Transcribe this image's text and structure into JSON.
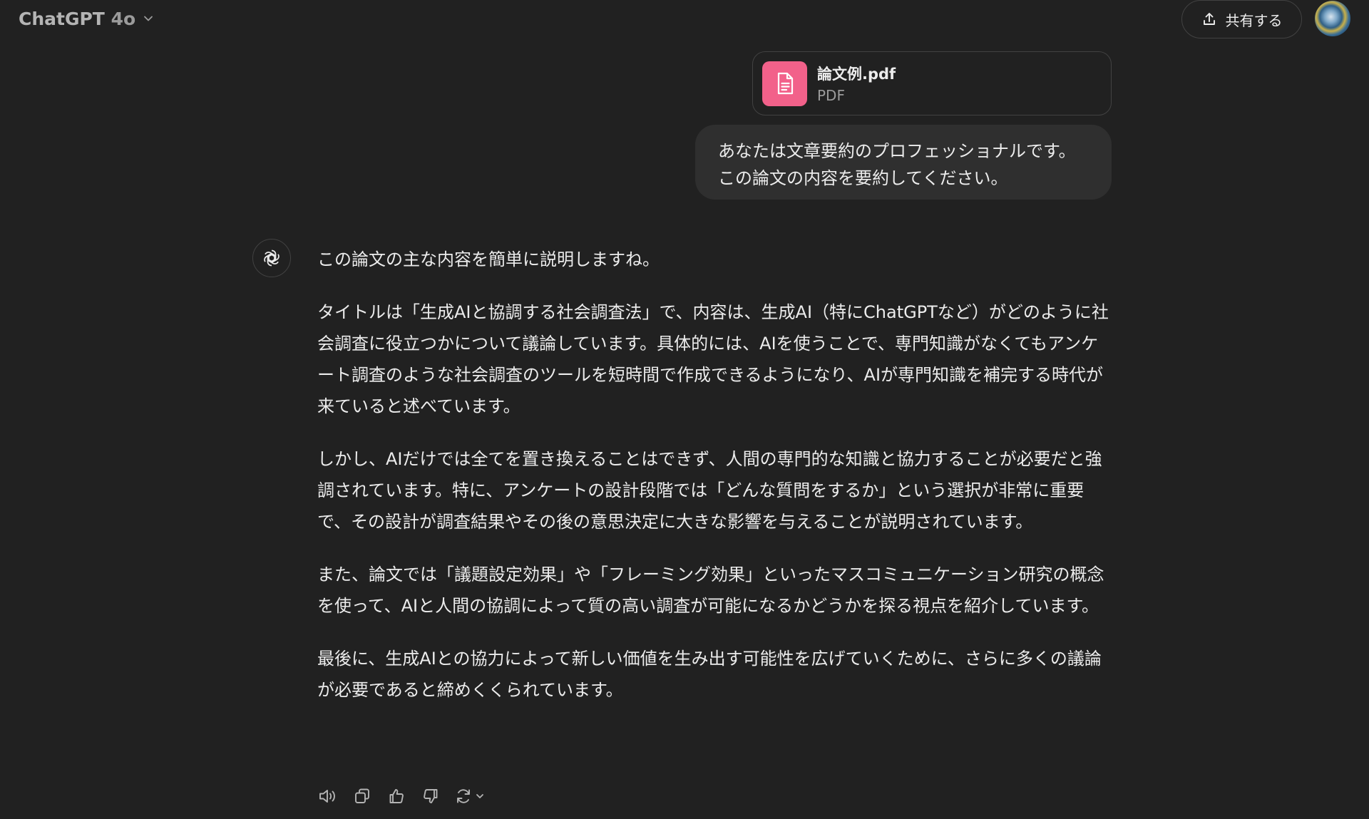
{
  "header": {
    "model_name": "ChatGPT",
    "model_version": "4o",
    "share_label": "共有する"
  },
  "attachment": {
    "file_name": "論文例.pdf",
    "file_type": "PDF",
    "icon": "document-icon",
    "icon_color": "#f2618a"
  },
  "user_message": {
    "lines": [
      "あなたは文章要約のプロフェッショナルです。",
      "この論文の内容を要約してください。"
    ]
  },
  "assistant_message": {
    "paragraphs": [
      "この論文の主な内容を簡単に説明しますね。",
      "タイトルは「生成AIと協調する社会調査法」で、内容は、生成AI（特にChatGPTなど）がどのように社会調査に役立つかについて議論しています。具体的には、AIを使うことで、専門知識がなくてもアンケート調査のような社会調査のツールを短時間で作成できるようになり、AIが専門知識を補完する時代が来ていると述べています。",
      "しかし、AIだけでは全てを置き換えることはできず、人間の専門的な知識と協力することが必要だと強調されています。特に、アンケートの設計段階では「どんな質問をするか」という選択が非常に重要で、その設計が調査結果やその後の意思決定に大きな影響を与えることが説明されています。",
      "また、論文では「議題設定効果」や「フレーミング効果」といったマスコミュニケーション研究の概念を使って、AIと人間の協調によって質の高い調査が可能になるかどうかを探る視点を紹介しています。",
      "最後に、生成AIとの協力によって新しい価値を生み出す可能性を広げていくために、さらに多くの議論が必要であると締めくくられています。"
    ]
  },
  "actions": [
    "read-aloud-icon",
    "copy-icon",
    "thumbs-up-icon",
    "thumbs-down-icon",
    "regenerate-icon"
  ],
  "colors": {
    "background": "#212121",
    "user_bubble": "#2f2f2f",
    "text": "#ececec",
    "muted": "#9b9b9b"
  }
}
